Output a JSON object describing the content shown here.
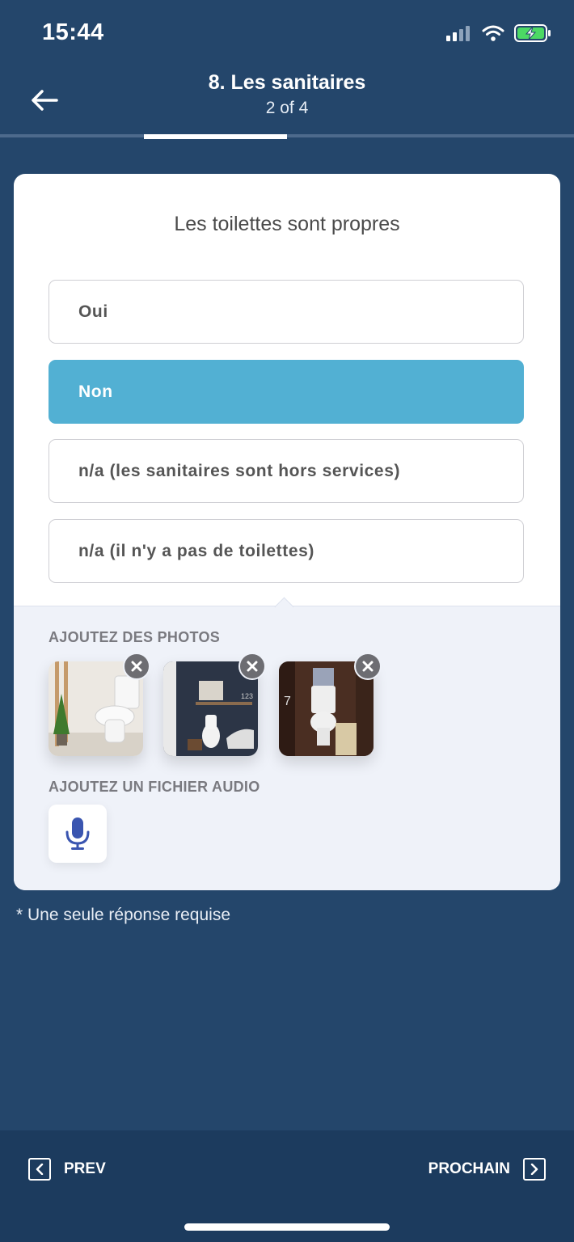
{
  "status": {
    "time": "15:44"
  },
  "header": {
    "title": "8. Les sanitaires",
    "step": "2 of 4"
  },
  "progress": {
    "current": 2,
    "total": 4
  },
  "question": {
    "text": "Les toilettes sont propres",
    "options": [
      {
        "label": "Oui",
        "selected": false
      },
      {
        "label": "Non",
        "selected": true
      },
      {
        "label": "n/a (les sanitaires sont hors services)",
        "selected": false
      },
      {
        "label": "n/a (il n'y a pas de toilettes)",
        "selected": false
      }
    ]
  },
  "attachments": {
    "photos_label": "AJOUTEZ DES PHOTOS",
    "audio_label": "AJOUTEZ UN FICHIER AUDIO",
    "photo_count": 3
  },
  "note": "* Une seule réponse requise",
  "nav": {
    "prev_label": "PREV",
    "next_label": "PROCHAIN"
  },
  "colors": {
    "background": "#24466b",
    "selected": "#52b0d3",
    "battery": "#4cd964",
    "mic": "#3a55b0"
  },
  "icons": [
    "back-arrow-icon",
    "signal-icon",
    "wifi-icon",
    "battery-charging-icon",
    "close-icon",
    "microphone-icon",
    "chevron-left-icon",
    "chevron-right-icon"
  ]
}
